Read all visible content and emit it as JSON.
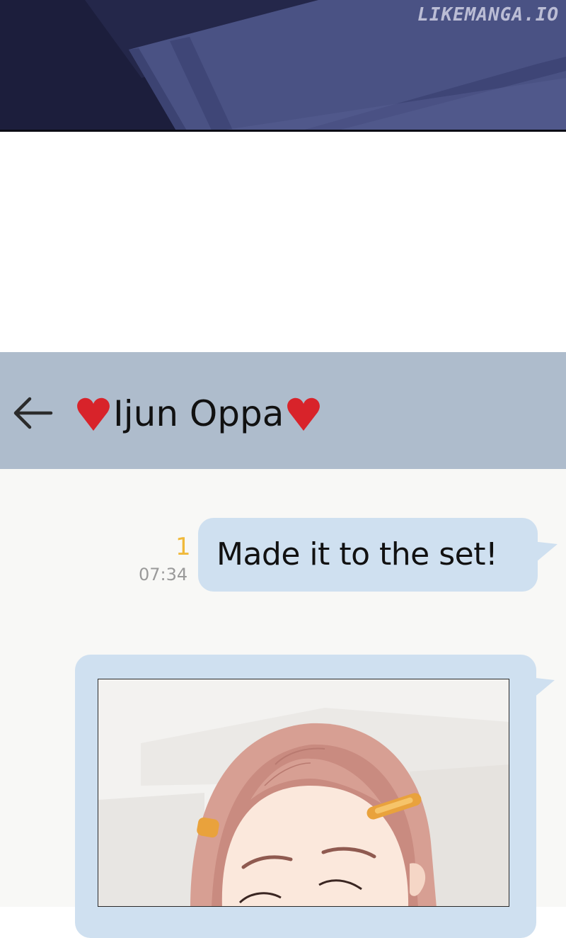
{
  "watermark": {
    "text": "LIKEMANGA.IO"
  },
  "header": {
    "back_icon": "arrow-left-icon",
    "title": "Ijun Oppa",
    "heart_icon": "heart-icon",
    "heart_color": "#d8232a",
    "background": "#aebccc"
  },
  "messages": [
    {
      "text": "Made it to the set!",
      "unread_count": "1",
      "time": "07:34",
      "bubble_color": "#cfe0f0"
    },
    {
      "type": "image",
      "bubble_color": "#cfe0f0"
    }
  ],
  "colors": {
    "unread": "#f0b93a",
    "time": "#9a9a9a",
    "chat_background": "#f8f8f6"
  }
}
